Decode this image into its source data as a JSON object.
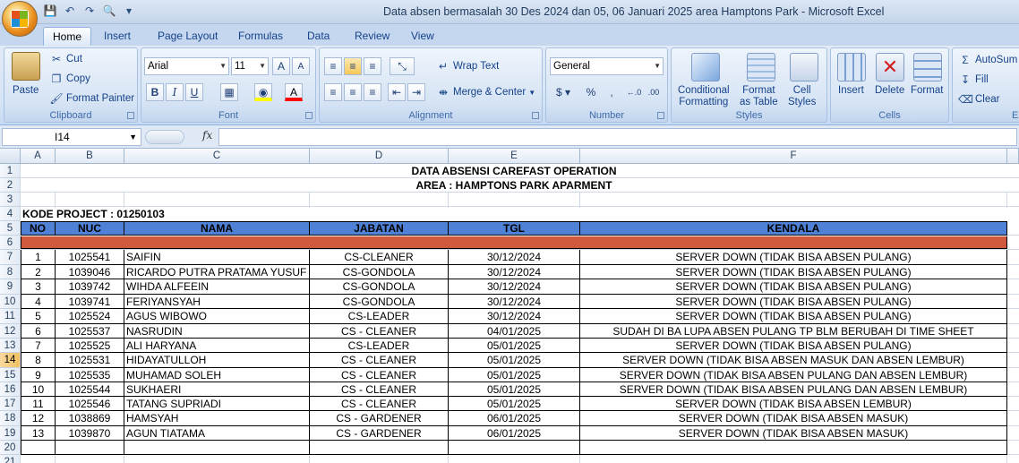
{
  "window": {
    "title": "Data absen bermasalah 30 Des 2024 dan 05, 06 Januari 2025 area Hamptons Park  -  Microsoft Excel"
  },
  "tabs": [
    "Home",
    "Insert",
    "Page Layout",
    "Formulas",
    "Data",
    "Review",
    "View"
  ],
  "ribbon": {
    "clipboard": {
      "paste": "Paste",
      "cut": "Cut",
      "copy": "Copy",
      "format_painter": "Format Painter",
      "label": "Clipboard"
    },
    "font": {
      "name": "Arial",
      "size": "11",
      "label": "Font"
    },
    "alignment": {
      "wrap_text": "Wrap Text",
      "merge_center": "Merge & Center",
      "label": "Alignment"
    },
    "number": {
      "format": "General",
      "label": "Number"
    },
    "styles": {
      "conditional": "Conditional",
      "conditional2": "Formatting",
      "format_as": "Format",
      "format_as2": "as Table",
      "cell": "Cell",
      "cell2": "Styles",
      "label": "Styles"
    },
    "cells": {
      "insert": "Insert",
      "delete": "Delete",
      "format": "Format",
      "label": "Cells"
    },
    "editing": {
      "autosum": "AutoSum",
      "fill": "Fill",
      "clear": "Clear",
      "label": "E"
    }
  },
  "formula_bar": {
    "name_box": "I14",
    "fx": "fx",
    "content": ""
  },
  "columns": [
    "A",
    "B",
    "C",
    "D",
    "E",
    "F"
  ],
  "rows": [
    "1",
    "2",
    "3",
    "4",
    "5",
    "6",
    "7",
    "8",
    "9",
    "10",
    "11",
    "12",
    "13",
    "14",
    "15",
    "16",
    "17",
    "18",
    "19",
    "20",
    "21"
  ],
  "sheet": {
    "title1": "DATA ABSENSI CAREFAST OPERATION",
    "title2": "AREA : HAMPTONS PARK APARMENT",
    "project": "KODE PROJECT : 01250103",
    "headers": [
      "NO",
      "NUC",
      "NAMA",
      "JABATAN",
      "TGL",
      "KENDALA"
    ],
    "records": [
      [
        "1",
        "1025541",
        "SAIFIN",
        "CS-CLEANER",
        "30/12/2024",
        "SERVER DOWN (TIDAK BISA ABSEN PULANG)"
      ],
      [
        "2",
        "1039046",
        "RICARDO PUTRA PRATAMA YUSUF",
        "CS-GONDOLA",
        "30/12/2024",
        "SERVER DOWN (TIDAK BISA ABSEN PULANG)"
      ],
      [
        "3",
        "1039742",
        "WIHDA ALFEEIN",
        "CS-GONDOLA",
        "30/12/2024",
        "SERVER DOWN (TIDAK BISA ABSEN PULANG)"
      ],
      [
        "4",
        "1039741",
        "FERIYANSYAH",
        "CS-GONDOLA",
        "30/12/2024",
        "SERVER DOWN (TIDAK BISA ABSEN PULANG)"
      ],
      [
        "5",
        "1025524",
        "AGUS WIBOWO",
        "CS-LEADER",
        "30/12/2024",
        "SERVER DOWN (TIDAK BISA ABSEN PULANG)"
      ],
      [
        "6",
        "1025537",
        "NASRUDIN",
        "CS - CLEANER",
        "04/01/2025",
        "SUDAH DI BA LUPA ABSEN PULANG TP BLM BERUBAH DI TIME SHEET"
      ],
      [
        "7",
        "1025525",
        "ALI HARYANA",
        "CS-LEADER",
        "05/01/2025",
        "SERVER DOWN (TIDAK BISA ABSEN PULANG)"
      ],
      [
        "8",
        "1025531",
        "HIDAYATULLOH",
        "CS - CLEANER",
        "05/01/2025",
        "SERVER DOWN (TIDAK BISA ABSEN MASUK DAN ABSEN LEMBUR)"
      ],
      [
        "9",
        "1025535",
        "MUHAMAD SOLEH",
        "CS - CLEANER",
        "05/01/2025",
        "SERVER DOWN (TIDAK BISA ABSEN PULANG DAN ABSEN LEMBUR)"
      ],
      [
        "10",
        "1025544",
        "SUKHAERI",
        "CS - CLEANER",
        "05/01/2025",
        "SERVER DOWN (TIDAK BISA ABSEN PULANG DAN ABSEN LEMBUR)"
      ],
      [
        "11",
        "1025546",
        "TATANG SUPRIADI",
        "CS - CLEANER",
        "05/01/2025",
        "SERVER DOWN (TIDAK BISA ABSEN LEMBUR)"
      ],
      [
        "12",
        "1038869",
        "HAMSYAH",
        "CS - GARDENER",
        "06/01/2025",
        "SERVER DOWN (TIDAK BISA ABSEN MASUK)"
      ],
      [
        "13",
        "1039870",
        "AGUN TIATAMA",
        "CS - GARDENER",
        "06/01/2025",
        "SERVER DOWN (TIDAK BISA ABSEN MASUK)"
      ]
    ]
  },
  "selected_row": "14",
  "colors": {
    "header_fill": "#4f81d6",
    "separator_fill": "#d05a3e",
    "selection": "#f1c15f"
  }
}
